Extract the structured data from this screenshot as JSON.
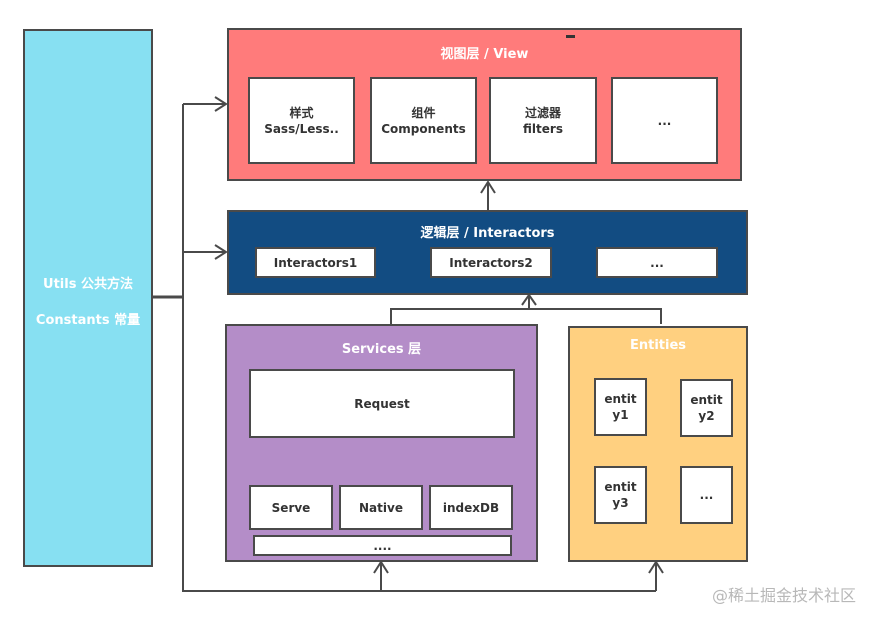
{
  "utils": {
    "line1": "Utils 公共方法",
    "line2": "Constants 常量",
    "color": "#87e0f2"
  },
  "view": {
    "title": "视图层 / View",
    "color": "#ff7b7b",
    "items": [
      {
        "line1": "样式",
        "line2": "Sass/Less.."
      },
      {
        "line1": "组件",
        "line2": "Components"
      },
      {
        "line1": "过滤器",
        "line2": "filters"
      },
      {
        "line1": "...",
        "line2": ""
      }
    ]
  },
  "interactors": {
    "title": "逻辑层 / Interactors",
    "color": "#124c82",
    "items": [
      "Interactors1",
      "Interactors2",
      "..."
    ]
  },
  "services": {
    "title": "Services 层",
    "color": "#b48dc8",
    "request": "Request",
    "items": [
      "Serve",
      "Native",
      "indexDB"
    ],
    "more": "...."
  },
  "entities": {
    "title": "Entities",
    "color": "#ffd080",
    "items": [
      {
        "line1": "entit",
        "line2": "y1"
      },
      {
        "line1": "entit",
        "line2": "y2"
      },
      {
        "line1": "entit",
        "line2": "y3"
      },
      {
        "line1": "...",
        "line2": ""
      }
    ]
  },
  "watermark": "@稀土掘金技术社区"
}
